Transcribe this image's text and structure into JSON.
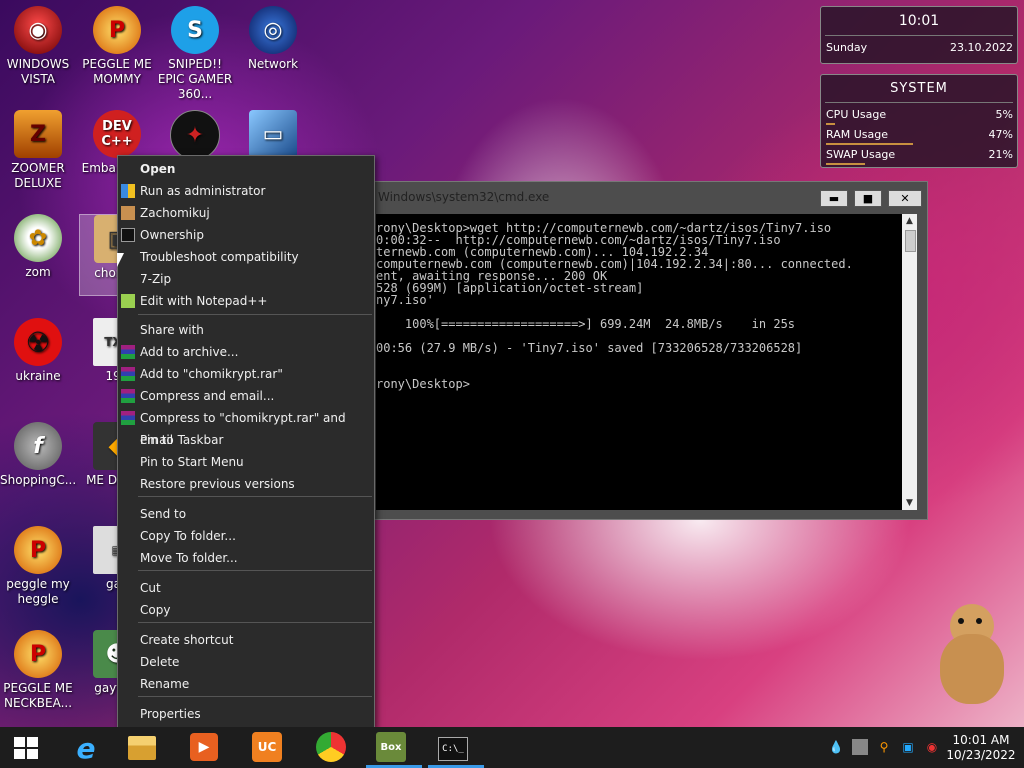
{
  "desktop_icons": [
    {
      "label": "WINDOWS VISTA",
      "icon": "vista-icon"
    },
    {
      "label": "PEGGLE ME MOMMY",
      "icon": "peggle-icon"
    },
    {
      "label": "SNIPED!! EPIC GAMER 360...",
      "icon": "skype-icon"
    },
    {
      "label": "Network",
      "icon": "network-icon"
    },
    {
      "label": "ZOOMER DELUXE",
      "icon": "zoomer-icon"
    },
    {
      "label": "Embar Dev-",
      "icon": "devcpp-icon"
    },
    {
      "label": "zom",
      "icon": "flower-icon"
    },
    {
      "label": "chomi x",
      "icon": "archive-icon"
    },
    {
      "label": "ukraine",
      "icon": "radiation-icon"
    },
    {
      "label": "198",
      "icon": "document-icon"
    },
    {
      "label": "ShoppingC...",
      "icon": "flash-icon"
    },
    {
      "label": "ME DESTR",
      "icon": "game-icon"
    },
    {
      "label": "peggle my heggle",
      "icon": "peggle-icon"
    },
    {
      "label": "gay",
      "icon": "document-icon"
    },
    {
      "label": "PEGGLE ME NECKBEA...",
      "icon": "peggle-icon"
    },
    {
      "label": "gayt po",
      "icon": "mascot-icon"
    }
  ],
  "context_menu": {
    "items": [
      {
        "label": "Open",
        "bold": true,
        "icon": ""
      },
      {
        "label": "Run as administrator",
        "icon": "shield-icon"
      },
      {
        "label": "Zachomikuj",
        "icon": "hamster-icon"
      },
      {
        "label": "Ownership",
        "icon": "cmd-icon"
      },
      {
        "label": "Troubleshoot compatibility",
        "icon": ""
      },
      {
        "label": "7-Zip",
        "icon": ""
      },
      {
        "label": "Edit with Notepad++",
        "icon": "notepad-icon"
      },
      {
        "label": "Share with",
        "icon": ""
      },
      {
        "label": "Add to archive...",
        "icon": "winrar-icon"
      },
      {
        "label": "Add to \"chomikrypt.rar\"",
        "icon": "winrar-icon"
      },
      {
        "label": "Compress and email...",
        "icon": "winrar-icon"
      },
      {
        "label": "Compress to \"chomikrypt.rar\" and email",
        "icon": "winrar-icon"
      },
      {
        "label": "Pin to Taskbar",
        "icon": ""
      },
      {
        "label": "Pin to Start Menu",
        "icon": ""
      },
      {
        "label": "Restore previous versions",
        "icon": ""
      },
      {
        "label": "Send to",
        "icon": ""
      },
      {
        "label": "Copy To folder...",
        "icon": ""
      },
      {
        "label": "Move To folder...",
        "icon": ""
      },
      {
        "label": "Cut",
        "icon": ""
      },
      {
        "label": "Copy",
        "icon": ""
      },
      {
        "label": "Create shortcut",
        "icon": ""
      },
      {
        "label": "Delete",
        "icon": ""
      },
      {
        "label": "Rename",
        "icon": ""
      },
      {
        "label": "Properties",
        "icon": ""
      }
    ]
  },
  "cmd_window": {
    "title": "Windows\\system32\\cmd.exe",
    "minimize": "▬",
    "maximize": "■",
    "close": "✕",
    "lines": [
      "rony\\Desktop>wget http://computernewb.com/~dartz/isos/Tiny7.iso",
      "0:00:32--  http://computernewb.com/~dartz/isos/Tiny7.iso",
      "ternewb.com (computernewb.com)... 104.192.2.34",
      "computernewb.com (computernewb.com)|104.192.2.34|:80... connected.",
      "ent, awaiting response... 200 OK",
      "528 (699M) [application/octet-stream]",
      "ny7.iso'",
      "",
      "    100%[===================>] 699.24M  24.8MB/s    in 25s",
      "",
      "00:56 (27.9 MB/s) - 'Tiny7.iso' saved [733206528/733206528]",
      "",
      "",
      "rony\\Desktop>"
    ]
  },
  "clock_gadget": {
    "time": "10:01",
    "day": "Sunday",
    "date": "23.10.2022"
  },
  "system_gadget": {
    "title": "SYSTEM",
    "rows": [
      {
        "label": "CPU Usage",
        "value": "5%",
        "fraction": 0.05
      },
      {
        "label": "RAM Usage",
        "value": "47%",
        "fraction": 0.47
      },
      {
        "label": "SWAP Usage",
        "value": "21%",
        "fraction": 0.21
      }
    ]
  },
  "taskbar": {
    "apps": [
      {
        "name": "internet-explorer-icon",
        "glyph": "e"
      },
      {
        "name": "file-explorer-icon",
        "glyph": ""
      },
      {
        "name": "media-player-icon",
        "glyph": "▶"
      },
      {
        "name": "uc-browser-icon",
        "glyph": "UC"
      },
      {
        "name": "chrome-icon",
        "glyph": ""
      },
      {
        "name": "hamster-box-icon",
        "glyph": "Box"
      },
      {
        "name": "cmd-icon",
        "glyph": "C:\\_"
      }
    ],
    "clock_time": "10:01 AM",
    "clock_date": "10/23/2022"
  },
  "colors": {
    "accent": "#1e90ff",
    "menu_bg": "#2b2b2b",
    "taskbar_bg": "#1d1d1d"
  }
}
